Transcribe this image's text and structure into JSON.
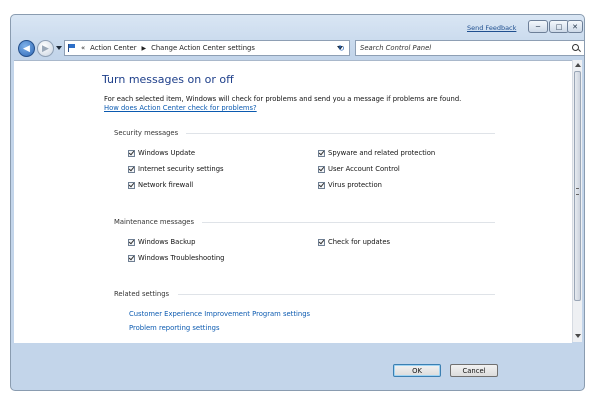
{
  "titlebar": {
    "send_feedback": "Send Feedback",
    "minimize": "─",
    "maximize": "□",
    "close": "✕"
  },
  "nav": {
    "back": "◀",
    "forward": "▶",
    "address": {
      "overflow": "«",
      "crumb1": "Action Center",
      "sep": "▶",
      "crumb2": "Change Action Center settings"
    },
    "refresh": "↻",
    "search_placeholder": "Search Control Panel"
  },
  "main": {
    "title": "Turn messages on or off",
    "description": "For each selected item, Windows will check for problems and send you a message if problems are found.",
    "help_link": "How does Action Center check for problems?",
    "security": {
      "label": "Security messages",
      "items": [
        {
          "label": "Windows Update",
          "checked": true
        },
        {
          "label": "Internet security settings",
          "checked": true
        },
        {
          "label": "Network firewall",
          "checked": true
        },
        {
          "label": "Spyware and related protection",
          "checked": true
        },
        {
          "label": "User Account Control",
          "checked": true
        },
        {
          "label": "Virus protection",
          "checked": true
        }
      ]
    },
    "maintenance": {
      "label": "Maintenance messages",
      "items": [
        {
          "label": "Windows Backup",
          "checked": true
        },
        {
          "label": "Windows Troubleshooting",
          "checked": true
        },
        {
          "label": "Check for updates",
          "checked": true
        }
      ]
    },
    "related": {
      "label": "Related settings",
      "links": [
        "Customer Experience Improvement Program settings",
        "Problem reporting settings"
      ]
    }
  },
  "footer": {
    "ok": "OK",
    "cancel": "Cancel"
  }
}
